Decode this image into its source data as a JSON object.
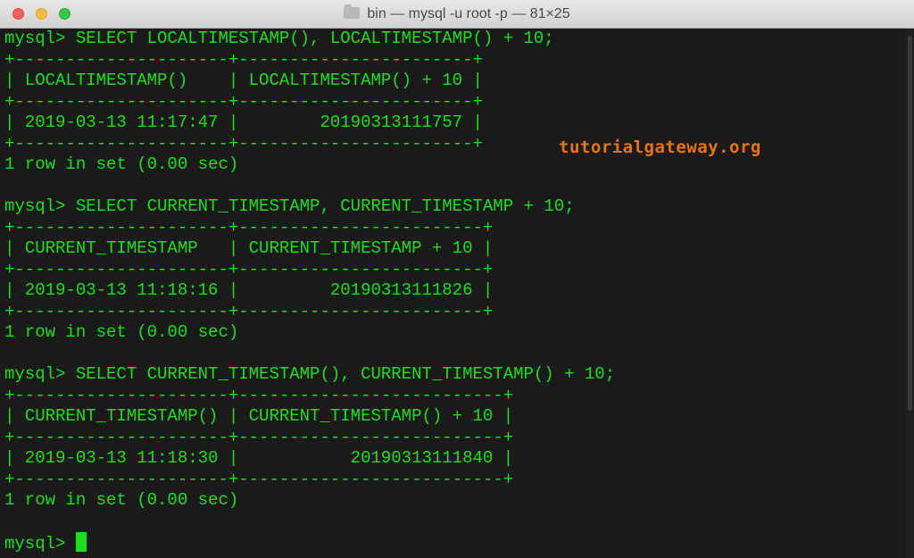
{
  "window": {
    "title": "bin — mysql -u root -p — 81×25"
  },
  "terminal": {
    "lines": [
      {
        "kind": "prompt",
        "text": "mysql> SELECT LOCALTIMESTAMP(), LOCALTIMESTAMP() + 10;"
      },
      {
        "kind": "border",
        "text": "+---------------------+-----------------------+"
      },
      {
        "kind": "row",
        "text": "| LOCALTIMESTAMP()    | LOCALTIMESTAMP() + 10 |"
      },
      {
        "kind": "border",
        "text": "+---------------------+-----------------------+"
      },
      {
        "kind": "row",
        "text": "| 2019-03-13 11:17:47 |        20190313111757 |"
      },
      {
        "kind": "border",
        "text": "+---------------------+-----------------------+"
      },
      {
        "kind": "status",
        "text": "1 row in set (0.00 sec)"
      },
      {
        "kind": "blank",
        "text": ""
      },
      {
        "kind": "prompt",
        "text": "mysql> SELECT CURRENT_TIMESTAMP, CURRENT_TIMESTAMP + 10;"
      },
      {
        "kind": "border",
        "text": "+---------------------+------------------------+"
      },
      {
        "kind": "row",
        "text": "| CURRENT_TIMESTAMP   | CURRENT_TIMESTAMP + 10 |"
      },
      {
        "kind": "border",
        "text": "+---------------------+------------------------+"
      },
      {
        "kind": "row",
        "text": "| 2019-03-13 11:18:16 |         20190313111826 |"
      },
      {
        "kind": "border",
        "text": "+---------------------+------------------------+"
      },
      {
        "kind": "status",
        "text": "1 row in set (0.00 sec)"
      },
      {
        "kind": "blank",
        "text": ""
      },
      {
        "kind": "prompt",
        "text": "mysql> SELECT CURRENT_TIMESTAMP(), CURRENT_TIMESTAMP() + 10;"
      },
      {
        "kind": "border",
        "text": "+---------------------+--------------------------+"
      },
      {
        "kind": "row",
        "text": "| CURRENT_TIMESTAMP() | CURRENT_TIMESTAMP() + 10 |"
      },
      {
        "kind": "border",
        "text": "+---------------------+--------------------------+"
      },
      {
        "kind": "row",
        "text": "| 2019-03-13 11:18:30 |           20190313111840 |"
      },
      {
        "kind": "border",
        "text": "+---------------------+--------------------------+"
      },
      {
        "kind": "status",
        "text": "1 row in set (0.00 sec)"
      },
      {
        "kind": "blank",
        "text": ""
      },
      {
        "kind": "input",
        "text": "mysql> "
      }
    ]
  },
  "watermark": {
    "text": "tutorialgateway.org"
  },
  "colors": {
    "terminal_text": "#19e019",
    "terminal_background": "#1a1a1a",
    "watermark": "#e8740c"
  }
}
